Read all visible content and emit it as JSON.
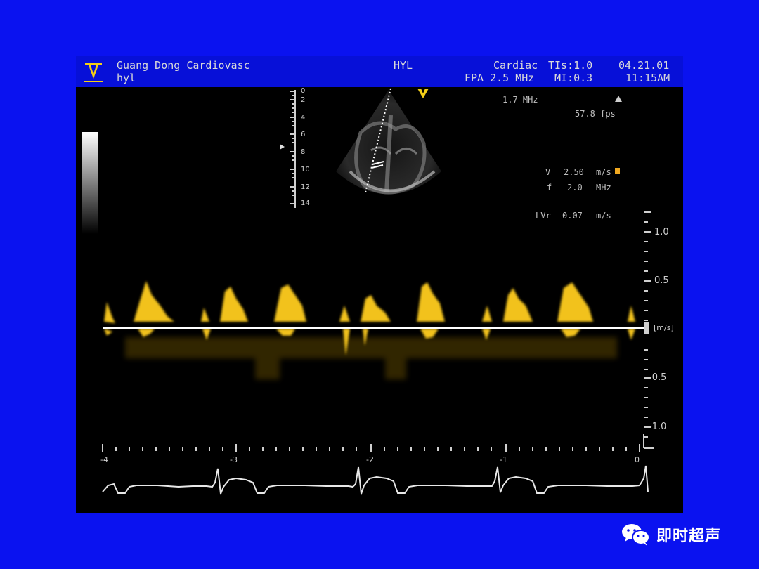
{
  "header": {
    "institution": "Guang Dong Cardiovasc",
    "patient": "hyl",
    "operator": "HYL",
    "preset": "Cardiac",
    "ti": "TIs:1.0",
    "date": "04.21.01",
    "probe": "FPA 2.5 MHz",
    "mi": "MI:0.3",
    "time": "11:15AM"
  },
  "imaging": {
    "frequency": "1.7 MHz",
    "frame_rate": "57.8 fps",
    "depth_ticks": [
      "0",
      "2",
      "4",
      "6",
      "8",
      "10",
      "12",
      "14"
    ]
  },
  "doppler": {
    "v_label": "V",
    "v_value": "2.50",
    "v_unit": "m/s",
    "f_label": "f",
    "f_value": "2.0",
    "f_unit": "MHz",
    "lvr_label": "LVr",
    "lvr_value": "0.07",
    "lvr_unit": "m/s"
  },
  "spectrum": {
    "velocity_ticks": [
      "1.0",
      "0.5",
      "[m/s]",
      "-0.5",
      "-1.0"
    ],
    "time_ticks": [
      "-4",
      "-3",
      "-2",
      "-1",
      "0"
    ]
  },
  "colors": {
    "background": "#0a12f0",
    "header_bar": "#0710d8",
    "doppler_signal": "#f2c21a"
  },
  "watermark": {
    "text": "即时超声",
    "icon": "wechat-icon"
  }
}
